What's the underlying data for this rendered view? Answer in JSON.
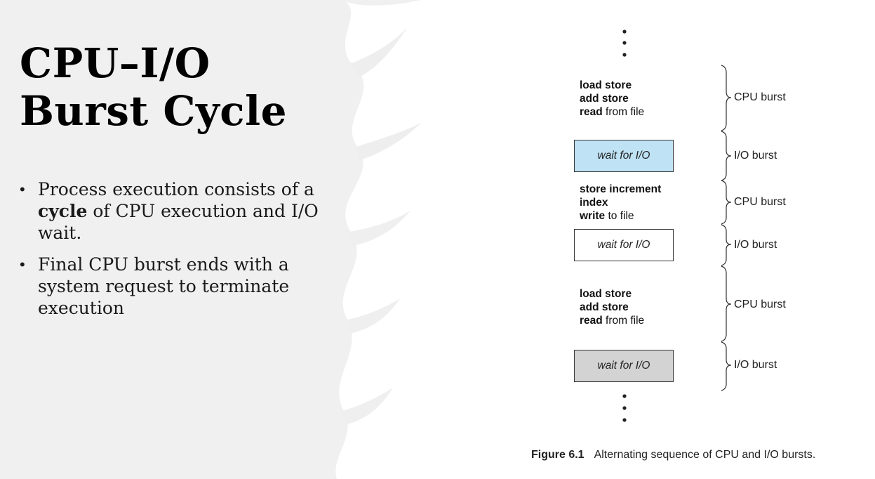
{
  "slide": {
    "title_line1": "CPU–I/O",
    "title_line2": "Burst Cycle",
    "bullets": [
      {
        "pre": "Process execution consists of a ",
        "bold": "cycle",
        "post": " of CPU execution and I/O wait."
      },
      {
        "pre": "Final CPU burst ends with a system request to terminate execution",
        "bold": "",
        "post": ""
      }
    ]
  },
  "diagram": {
    "segments": [
      {
        "kind": "cpu",
        "lines": [
          {
            "bold": "load store",
            "rest": ""
          },
          {
            "bold": "add store",
            "rest": ""
          },
          {
            "bold": "read",
            "rest": " from file"
          }
        ],
        "label": "CPU burst"
      },
      {
        "kind": "io",
        "text": "wait for I/O",
        "fill": "#bfe3f5",
        "label": "I/O burst"
      },
      {
        "kind": "cpu",
        "lines": [
          {
            "bold": "store increment",
            "rest": ""
          },
          {
            "bold": "index",
            "rest": ""
          },
          {
            "bold": "write",
            "rest": " to file"
          }
        ],
        "label": "CPU burst"
      },
      {
        "kind": "io",
        "text": "wait for I/O",
        "fill": "#ffffff",
        "label": "I/O burst"
      },
      {
        "kind": "cpu",
        "lines": [
          {
            "bold": "load store",
            "rest": ""
          },
          {
            "bold": "add store",
            "rest": ""
          },
          {
            "bold": "read",
            "rest": " from file"
          }
        ],
        "label": "CPU burst"
      },
      {
        "kind": "io",
        "text": "wait for I/O",
        "fill": "#d3d3d3",
        "label": "I/O burst"
      }
    ],
    "caption_number": "Figure 6.1",
    "caption_text": "Alternating sequence of CPU and I/O bursts."
  }
}
